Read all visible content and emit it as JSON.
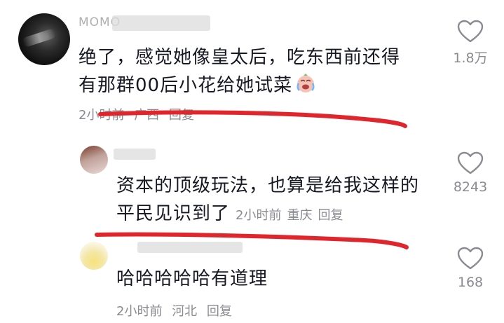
{
  "comments": [
    {
      "username": "MOMO",
      "text_line1": "绝了，感觉她像皇太后，吃东西前还得",
      "text_line2": "有那群00后小花给她试菜",
      "emoji": "crying-laughing-emoji",
      "time": "2小时前",
      "location": "广西",
      "reply": "回复",
      "likes": "1.8万"
    },
    {
      "username": "",
      "text_line1": "资本的顶级玩法，也算是给我这样的",
      "text_line2": "平民见识到了",
      "time": "2小时前",
      "location": "重庆",
      "reply": "回复",
      "likes": "8243"
    },
    {
      "username": "",
      "text_line1": "哈哈哈哈哈有道理",
      "time": "2小时前",
      "location": "河北",
      "reply": "回复",
      "likes": "168"
    }
  ],
  "colors": {
    "text": "#161823",
    "meta": "#8a8b91",
    "underline": "#e0262c",
    "heart": "#8a8b91"
  }
}
